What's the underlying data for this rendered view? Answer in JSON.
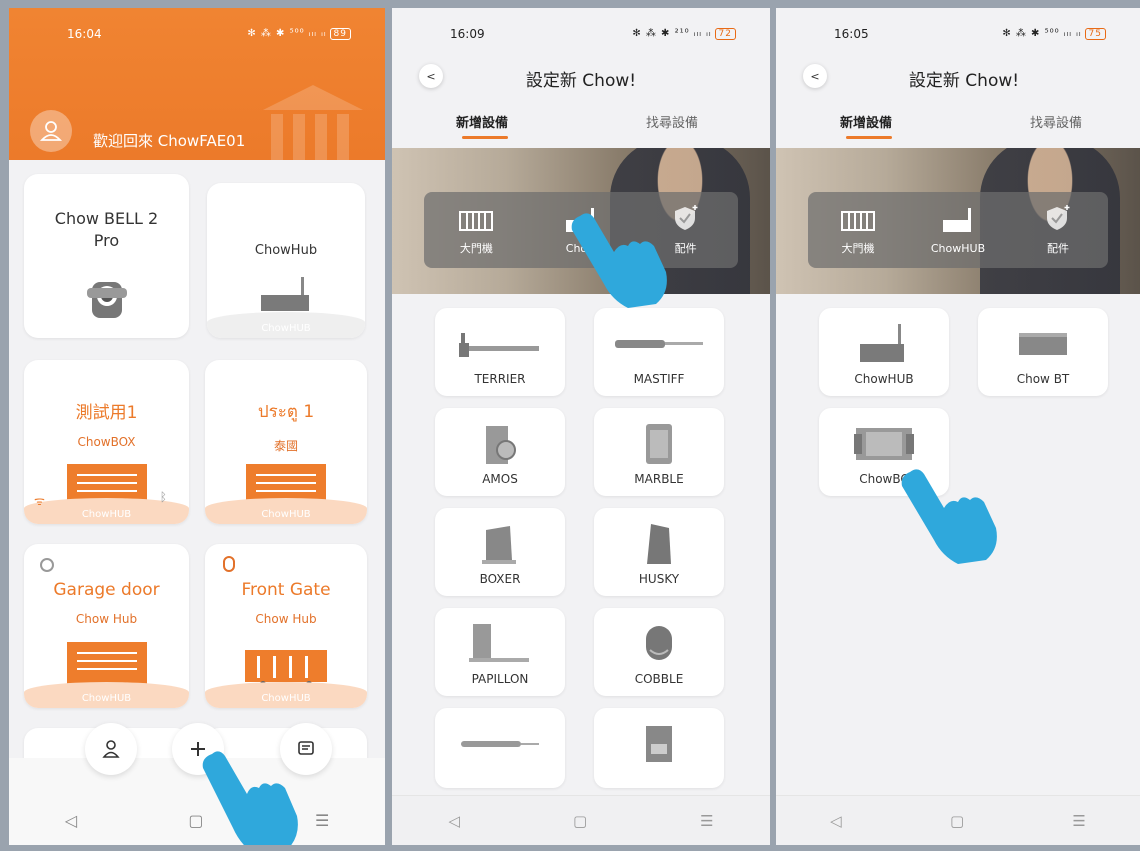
{
  "colors": {
    "accent": "#ec7a2a",
    "hand": "#2fa8dc"
  },
  "phone1": {
    "status_time": "16:04",
    "status_icons": "✻ ⁂ ✱ ⁵⁰⁰ ᵢₗₗ ᵢₗ",
    "battery": "89",
    "welcome": "歡迎回來 ChowFAE01",
    "cards": [
      {
        "title": "Chow BELL 2 Pro"
      },
      {
        "title": "ChowHub",
        "footer": "ChowHUB"
      },
      {
        "title": "測試用1",
        "subtitle": "ChowBOX",
        "footer": "ChowHUB"
      },
      {
        "title": "ประตู 1",
        "subtitle": "泰國",
        "footer": "ChowHUB"
      },
      {
        "title": "Garage door",
        "subtitle": "Chow Hub",
        "footer": "ChowHUB"
      },
      {
        "title": "Front Gate",
        "subtitle": "Chow Hub",
        "footer": "ChowHUB"
      }
    ],
    "nav_icons": [
      "user-icon",
      "add-icon",
      "message-icon"
    ]
  },
  "phone2": {
    "status_time": "16:09",
    "status_icons": "✻ ⁂ ✱ ²¹⁰ ᵢₗₗ ᵢₗ",
    "battery": "72",
    "title": "設定新 Chow!",
    "tabs": [
      "新增設備",
      "找尋設備"
    ],
    "categories": [
      "大門機",
      "Chow",
      "配件"
    ],
    "devices": [
      "TERRIER",
      "MASTIFF",
      "AMOS",
      "MARBLE",
      "BOXER",
      "HUSKY",
      "PAPILLON",
      "COBBLE"
    ]
  },
  "phone3": {
    "status_time": "16:05",
    "status_icons": "✻ ⁂ ✱ ⁵⁰⁰ ᵢₗₗ ᵢₗ",
    "battery": "75",
    "title": "設定新 Chow!",
    "tabs": [
      "新增設備",
      "找尋設備"
    ],
    "categories": [
      "大門機",
      "ChowHUB",
      "配件"
    ],
    "devices": [
      "ChowHUB",
      "Chow BT",
      "ChowBC"
    ]
  },
  "sysnav": {
    "back": "◁",
    "home": "▢",
    "menu": "☰"
  }
}
